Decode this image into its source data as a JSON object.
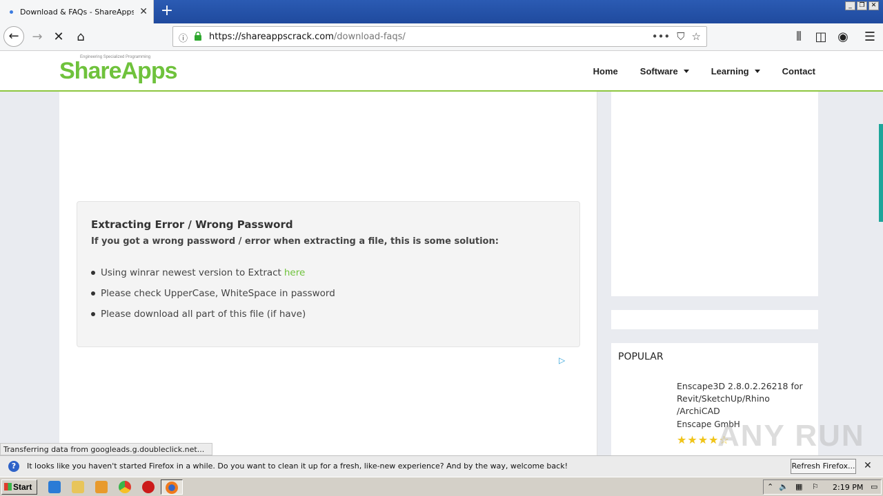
{
  "browser": {
    "tab_title": "Download & FAQs - ShareAppsCra",
    "url_host": "https://shareappscrack.com",
    "url_path": "/download-faqs/",
    "menu_dots": "•••"
  },
  "site": {
    "logo": "ShareApps",
    "logo_small": "Engineering Specialized Programming",
    "nav": {
      "home": "Home",
      "software": "Software",
      "learning": "Learning",
      "contact": "Contact"
    }
  },
  "faq": {
    "heading": "Extracting Error / Wrong Password",
    "lead": "If you got a wrong password / error when extracting a file, this is some solution:",
    "items": [
      {
        "text": "Using winrar newest version to Extract",
        "link": "here"
      },
      {
        "text": "Please check UpperCase, WhiteSpace in password"
      },
      {
        "text": "Please download all part of this file (if have)"
      }
    ]
  },
  "sidebar": {
    "popular_heading": "POPULAR",
    "popular_title": "Enscape3D 2.8.0.2.26218 for Revit/SketchUp/Rhino /ArchiCAD",
    "popular_vendor": "Enscape GmbH",
    "popular_stars": "★★★★☆"
  },
  "status": {
    "transfer": "Transferring data from googleads.g.doubleclick.net..."
  },
  "notification": {
    "message": "It looks like you haven't started Firefox in a while. Do you want to clean it up for a fresh, like-new experience? And by the way, welcome back!",
    "button": "Refresh Firefox..."
  },
  "taskbar": {
    "start": "Start",
    "time": "2:19 PM"
  },
  "watermark": "ANY RUN"
}
